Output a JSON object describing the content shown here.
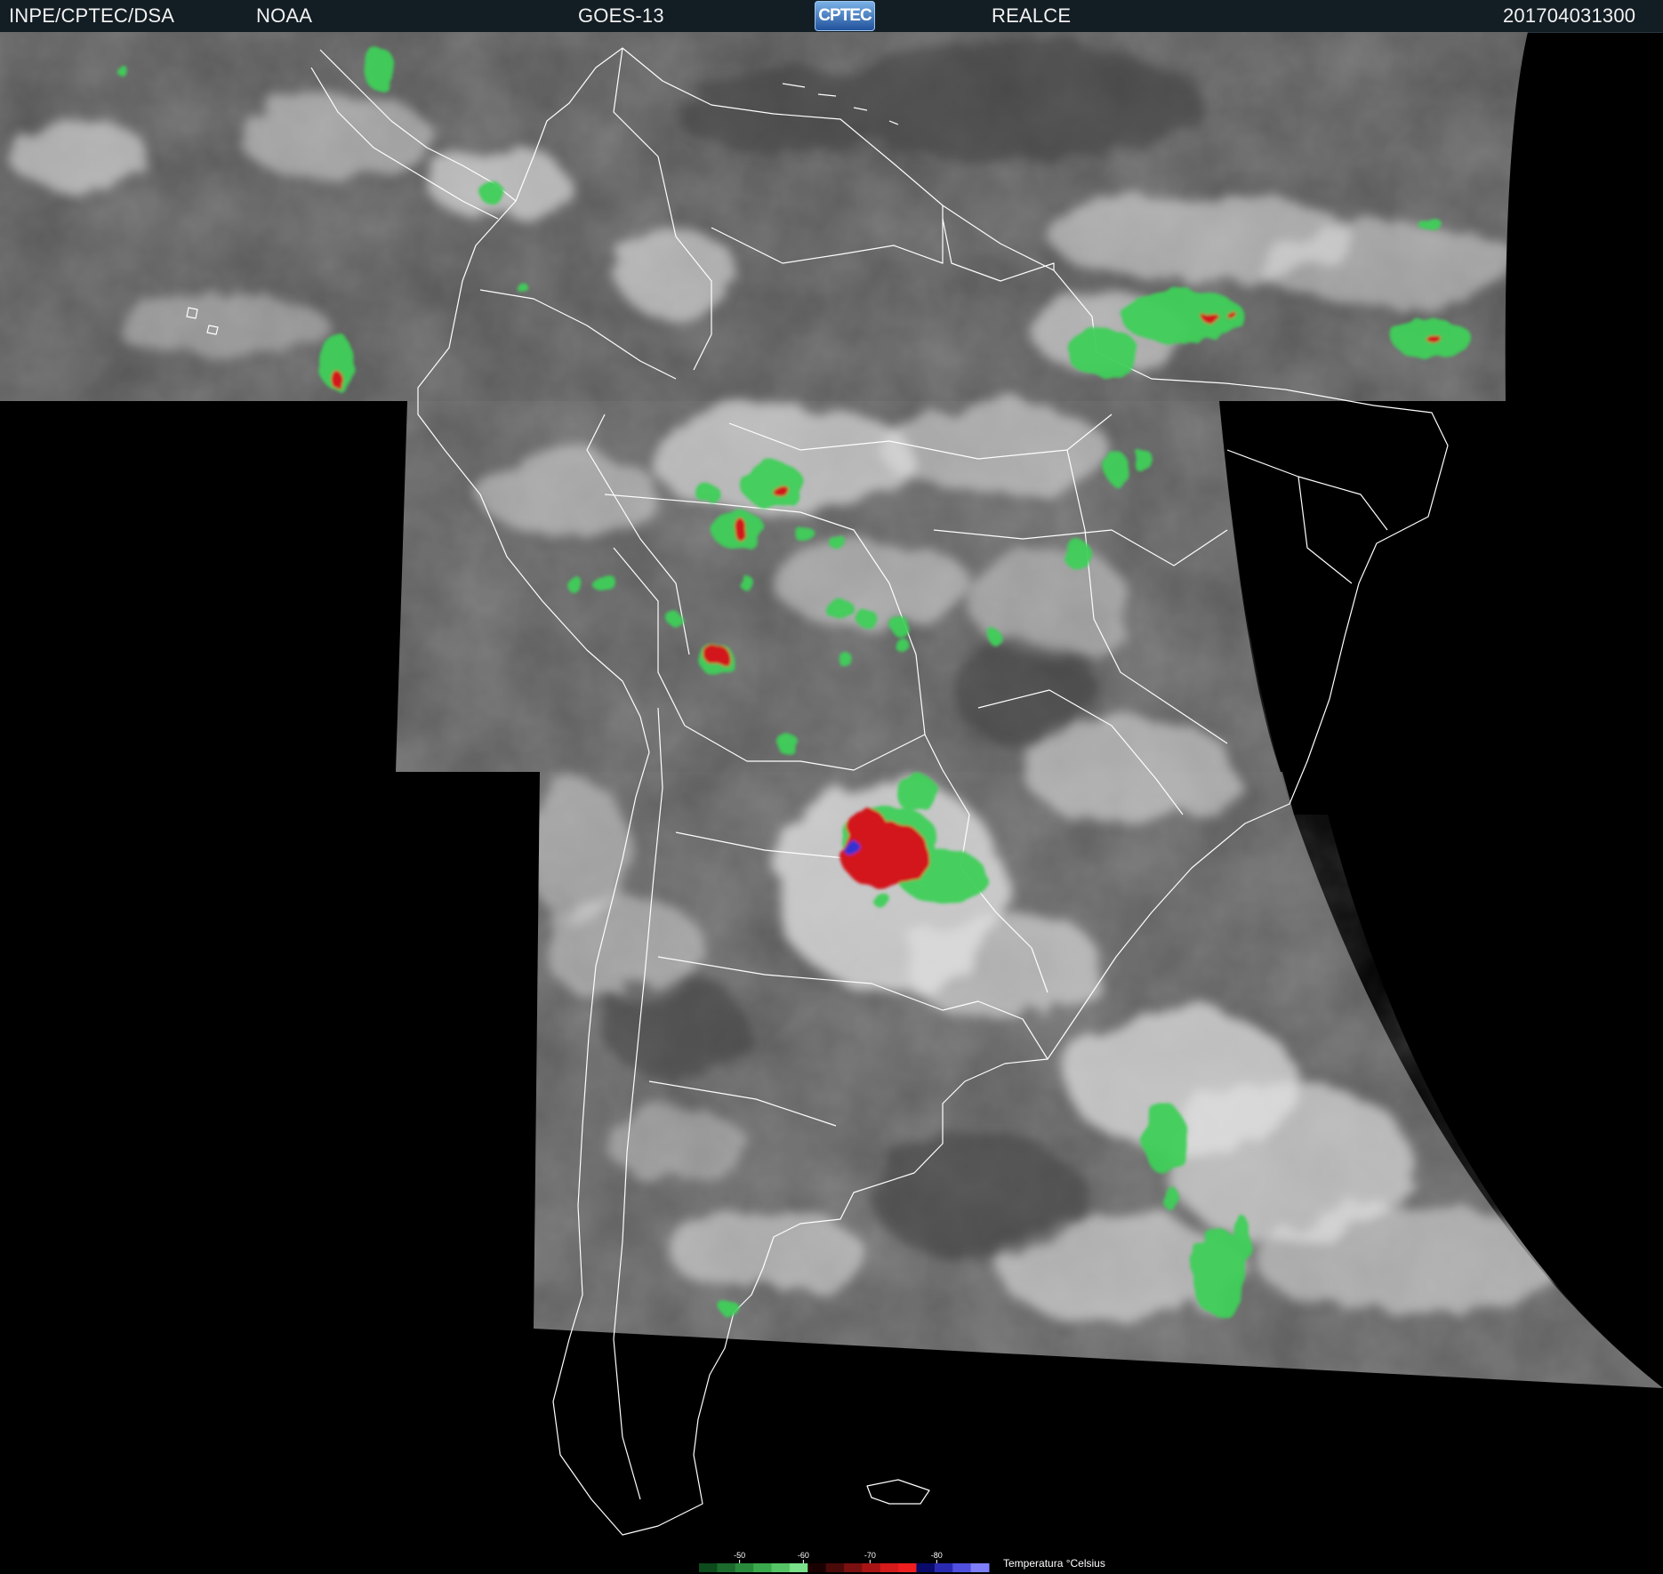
{
  "header": {
    "institution": "INPE/CPTEC/DSA",
    "agency": "NOAA",
    "satellite": "GOES-13",
    "logo_text": "CPTEC",
    "product": "REALCE",
    "timestamp": "201704031300"
  },
  "legend": {
    "title": "Temperatura °Celsius",
    "ticks": [
      {
        "value": "-50",
        "pos": 0.14
      },
      {
        "value": "-60",
        "pos": 0.36
      },
      {
        "value": "-70",
        "pos": 0.59
      },
      {
        "value": "-80",
        "pos": 0.82
      }
    ],
    "colors": [
      "#0d4a1c",
      "#1c6a2c",
      "#2a8a3c",
      "#3aa84c",
      "#56c466",
      "#7ae08a",
      "#1a0000",
      "#4a0a0a",
      "#7a1010",
      "#a81414",
      "#d41a1a",
      "#f01e1e",
      "#0a0a6a",
      "#2a2ab0",
      "#5050e0",
      "#7e7efa"
    ]
  },
  "colors": {
    "header_bg": "#131d24",
    "ocean_panel": "#5b5b5b",
    "cloud": "#e6e6e6",
    "border_lines": "#ffffff",
    "enhance_green": "#3fcf5a",
    "enhance_red": "#d2141e",
    "enhance_blue": "#3030d0"
  }
}
